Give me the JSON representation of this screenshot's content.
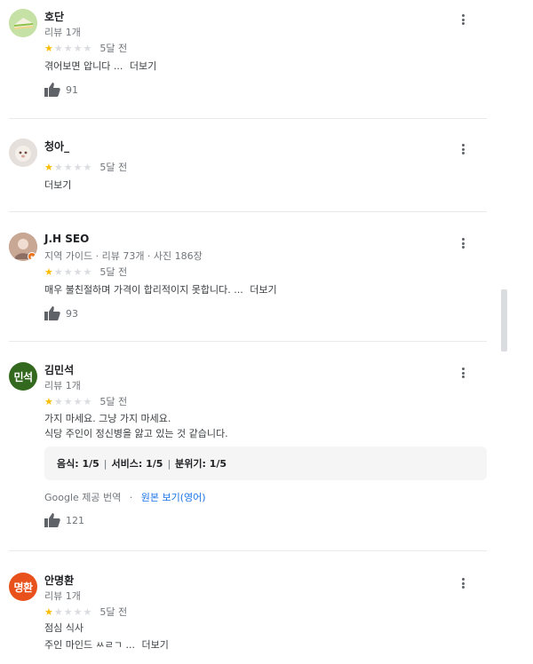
{
  "reviews": [
    {
      "name": "호단",
      "sub": "리뷰 1개",
      "avatar_color": "#c5e1a5",
      "avatar_icon": "cake-photo",
      "stars": 1,
      "time": "5달 전",
      "text_lines": [
        "겪어보면 압니다 ..."
      ],
      "more_label": "더보기",
      "likes": "91"
    },
    {
      "name": "청아_",
      "sub": "",
      "avatar_color": "#e6e0dc",
      "avatar_icon": "profile-photo",
      "stars": 1,
      "time": "5달 전",
      "text_lines": [],
      "more_label": "더보기",
      "likes": ""
    },
    {
      "name": "J.H SEO",
      "sub": "지역 가이드 · 리뷰 73개 · 사진 186장",
      "avatar_color": "#b88e7a",
      "avatar_icon": "profile-photo",
      "stars": 1,
      "time": "5달 전",
      "text_lines": [
        "매우 불친절하며 가격이 합리적이지 못합니다. ..."
      ],
      "more_label": "더보기",
      "likes": "93"
    },
    {
      "name": "김민석",
      "sub": "리뷰 1개",
      "avatar_color": "#33691e",
      "avatar_letters": "민석",
      "stars": 1,
      "time": "5달 전",
      "text_lines": [
        "가지 마세요. 그냥 가지 마세요.",
        "식당 주인이 정신병을 앓고 있는 것 같습니다."
      ],
      "scores": [
        "음식: 1/5",
        "서비스: 1/5",
        "분위기: 1/5"
      ],
      "translation": "Google 제공 번역",
      "original_link": "원본 보기(영어)",
      "likes": "121"
    },
    {
      "name": "안명환",
      "sub": "리뷰 1개",
      "avatar_color": "#e8511b",
      "avatar_letters": "명환",
      "stars": 1,
      "time": "5달 전",
      "text_lines": [
        "점심 식사",
        "주인 마인드 ㅆㄹㄱ ..."
      ],
      "more_label": "더보기",
      "likes": ""
    }
  ],
  "colors": {
    "star_on": "#fbbc04",
    "star_off": "#dadce0",
    "link": "#1a73e8"
  }
}
